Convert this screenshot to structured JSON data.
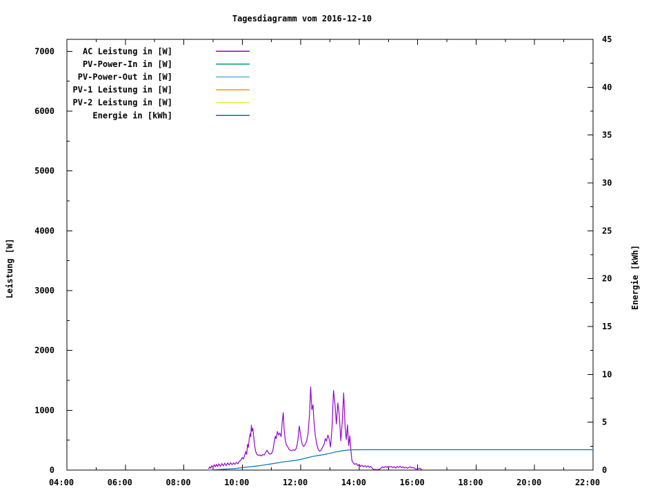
{
  "title": "Tagesdiagramm vom 2016-12-10",
  "chart_data": {
    "type": "line",
    "title": "Tagesdiagramm vom 2016-12-10",
    "background_color": "#ffffff",
    "axis_color": "#000000",
    "grid": false,
    "legend_position": "top-left-inside",
    "legend": [
      {
        "label": "AC Leistung in [W]",
        "color": "#9400d3"
      },
      {
        "label": "PV-Power-In in [W]",
        "color": "#009e73"
      },
      {
        "label": "PV-Power-Out in [W]",
        "color": "#56b4e9"
      },
      {
        "label": "PV-1 Leistung in [W]",
        "color": "#e69f00"
      },
      {
        "label": "PV-2 Leistung in [W]",
        "color": "#f0e442"
      },
      {
        "label": "Energie in [kWh]",
        "color": "#0072b2"
      }
    ],
    "x_axis": {
      "unit": "time",
      "min_hour": 4,
      "max_hour": 22,
      "major_tick_hours": [
        4,
        6,
        8,
        10,
        12,
        14,
        16,
        18,
        20,
        22
      ],
      "tick_labels": [
        "04:00",
        "06:00",
        "08:00",
        "10:00",
        "12:00",
        "14:00",
        "16:00",
        "18:00",
        "20:00",
        "22:00"
      ],
      "minor_tick_hours": [
        5,
        7,
        9,
        11,
        13,
        15,
        17,
        19,
        21
      ]
    },
    "y_left": {
      "label": "Leistung [W]",
      "min": 0,
      "max": 7200,
      "major_ticks": [
        0,
        1000,
        2000,
        3000,
        4000,
        5000,
        6000,
        7000
      ],
      "tick_labels": [
        "0",
        "1000",
        "2000",
        "3000",
        "4000",
        "5000",
        "6000",
        "7000"
      ],
      "minor_ticks": [
        500,
        1500,
        2500,
        3500,
        4500,
        5500,
        6500
      ]
    },
    "y_right": {
      "label": "Energie [kWh]",
      "min": 0,
      "max": 45,
      "major_ticks": [
        0,
        5,
        10,
        15,
        20,
        25,
        30,
        35,
        40,
        45
      ],
      "tick_labels": [
        "0",
        "5",
        "10",
        "15",
        "20",
        "25",
        "30",
        "35",
        "40",
        "45"
      ],
      "minor_ticks": [
        2.5,
        7.5,
        12.5,
        17.5,
        22.5,
        27.5,
        32.5,
        37.5,
        42.5
      ]
    },
    "series": [
      {
        "name": "AC Leistung in [W]",
        "axis": "left",
        "unit": "W",
        "color": "#9400d3",
        "points": [
          [
            8.85,
            20
          ],
          [
            8.88,
            55
          ],
          [
            8.92,
            30
          ],
          [
            8.96,
            75
          ],
          [
            9.0,
            45
          ],
          [
            9.04,
            90
          ],
          [
            9.08,
            55
          ],
          [
            9.12,
            95
          ],
          [
            9.16,
            60
          ],
          [
            9.2,
            105
          ],
          [
            9.25,
            60
          ],
          [
            9.3,
            110
          ],
          [
            9.35,
            70
          ],
          [
            9.4,
            115
          ],
          [
            9.45,
            75
          ],
          [
            9.5,
            120
          ],
          [
            9.55,
            85
          ],
          [
            9.6,
            125
          ],
          [
            9.65,
            90
          ],
          [
            9.7,
            120
          ],
          [
            9.75,
            95
          ],
          [
            9.8,
            130
          ],
          [
            9.85,
            105
          ],
          [
            9.9,
            145
          ],
          [
            9.95,
            165
          ],
          [
            10.0,
            210
          ],
          [
            10.04,
            185
          ],
          [
            10.08,
            245
          ],
          [
            10.12,
            310
          ],
          [
            10.15,
            260
          ],
          [
            10.18,
            430
          ],
          [
            10.21,
            380
          ],
          [
            10.24,
            530
          ],
          [
            10.27,
            610
          ],
          [
            10.29,
            560
          ],
          [
            10.31,
            750
          ],
          [
            10.33,
            650
          ],
          [
            10.36,
            700
          ],
          [
            10.39,
            560
          ],
          [
            10.42,
            420
          ],
          [
            10.46,
            310
          ],
          [
            10.5,
            265
          ],
          [
            10.55,
            245
          ],
          [
            10.6,
            255
          ],
          [
            10.65,
            235
          ],
          [
            10.7,
            260
          ],
          [
            10.75,
            250
          ],
          [
            10.8,
            295
          ],
          [
            10.85,
            330
          ],
          [
            10.9,
            285
          ],
          [
            10.95,
            265
          ],
          [
            11.0,
            275
          ],
          [
            11.05,
            330
          ],
          [
            11.1,
            490
          ],
          [
            11.13,
            565
          ],
          [
            11.16,
            525
          ],
          [
            11.2,
            645
          ],
          [
            11.24,
            585
          ],
          [
            11.28,
            620
          ],
          [
            11.33,
            560
          ],
          [
            11.37,
            820
          ],
          [
            11.4,
            960
          ],
          [
            11.43,
            710
          ],
          [
            11.46,
            545
          ],
          [
            11.5,
            430
          ],
          [
            11.55,
            395
          ],
          [
            11.6,
            345
          ],
          [
            11.65,
            330
          ],
          [
            11.7,
            325
          ],
          [
            11.75,
            340
          ],
          [
            11.8,
            330
          ],
          [
            11.85,
            365
          ],
          [
            11.9,
            490
          ],
          [
            11.95,
            735
          ],
          [
            12.0,
            565
          ],
          [
            12.05,
            430
          ],
          [
            12.1,
            395
          ],
          [
            12.15,
            425
          ],
          [
            12.2,
            485
          ],
          [
            12.25,
            610
          ],
          [
            12.3,
            920
          ],
          [
            12.34,
            1390
          ],
          [
            12.38,
            1010
          ],
          [
            12.42,
            1090
          ],
          [
            12.45,
            830
          ],
          [
            12.5,
            570
          ],
          [
            12.55,
            430
          ],
          [
            12.6,
            345
          ],
          [
            12.65,
            315
          ],
          [
            12.7,
            335
          ],
          [
            12.75,
            385
          ],
          [
            12.8,
            430
          ],
          [
            12.84,
            525
          ],
          [
            12.88,
            485
          ],
          [
            12.93,
            585
          ],
          [
            12.97,
            525
          ],
          [
            13.02,
            385
          ],
          [
            13.07,
            710
          ],
          [
            13.12,
            1330
          ],
          [
            13.17,
            1110
          ],
          [
            13.22,
            770
          ],
          [
            13.27,
            1120
          ],
          [
            13.32,
            910
          ],
          [
            13.37,
            490
          ],
          [
            13.42,
            810
          ],
          [
            13.47,
            1290
          ],
          [
            13.52,
            710
          ],
          [
            13.56,
            510
          ],
          [
            13.6,
            755
          ],
          [
            13.64,
            410
          ],
          [
            13.68,
            570
          ],
          [
            13.72,
            310
          ],
          [
            13.75,
            160
          ],
          [
            13.8,
            120
          ],
          [
            13.85,
            95
          ],
          [
            13.9,
            110
          ],
          [
            13.95,
            75
          ],
          [
            14.0,
            95
          ],
          [
            14.05,
            60
          ],
          [
            14.1,
            80
          ],
          [
            14.15,
            55
          ],
          [
            14.2,
            75
          ],
          [
            14.25,
            50
          ],
          [
            14.3,
            70
          ],
          [
            14.35,
            45
          ],
          [
            14.4,
            60
          ],
          [
            14.45,
            25
          ],
          [
            14.5,
            12
          ],
          [
            14.6,
            8
          ],
          [
            14.7,
            15
          ],
          [
            14.75,
            35
          ],
          [
            14.8,
            55
          ],
          [
            14.85,
            40
          ],
          [
            14.9,
            60
          ],
          [
            14.95,
            45
          ],
          [
            15.0,
            65
          ],
          [
            15.05,
            50
          ],
          [
            15.1,
            60
          ],
          [
            15.15,
            40
          ],
          [
            15.2,
            55
          ],
          [
            15.25,
            35
          ],
          [
            15.3,
            60
          ],
          [
            15.35,
            45
          ],
          [
            15.4,
            65
          ],
          [
            15.45,
            40
          ],
          [
            15.5,
            55
          ],
          [
            15.55,
            35
          ],
          [
            15.6,
            50
          ],
          [
            15.65,
            30
          ],
          [
            15.7,
            45
          ],
          [
            15.75,
            55
          ],
          [
            15.8,
            35
          ],
          [
            15.85,
            45
          ],
          [
            15.9,
            25
          ],
          [
            15.95,
            15
          ],
          [
            16.0,
            22
          ],
          [
            16.08,
            30
          ],
          [
            16.15,
            5
          ]
        ]
      },
      {
        "name": "Energie in [kWh]",
        "axis": "right",
        "unit": "kWh",
        "color": "#0072b2",
        "points": [
          [
            8.85,
            0.0
          ],
          [
            9.1,
            0.04
          ],
          [
            9.45,
            0.1
          ],
          [
            9.8,
            0.18
          ],
          [
            10.0,
            0.25
          ],
          [
            10.3,
            0.36
          ],
          [
            10.6,
            0.46
          ],
          [
            11.0,
            0.65
          ],
          [
            11.4,
            0.85
          ],
          [
            11.8,
            1.0
          ],
          [
            12.0,
            1.12
          ],
          [
            12.2,
            1.26
          ],
          [
            12.4,
            1.42
          ],
          [
            12.6,
            1.52
          ],
          [
            12.8,
            1.62
          ],
          [
            13.0,
            1.75
          ],
          [
            13.2,
            1.9
          ],
          [
            13.45,
            2.03
          ],
          [
            13.6,
            2.09
          ],
          [
            13.8,
            2.12
          ],
          [
            14.0,
            2.13
          ],
          [
            22.0,
            2.13
          ]
        ]
      }
    ]
  }
}
